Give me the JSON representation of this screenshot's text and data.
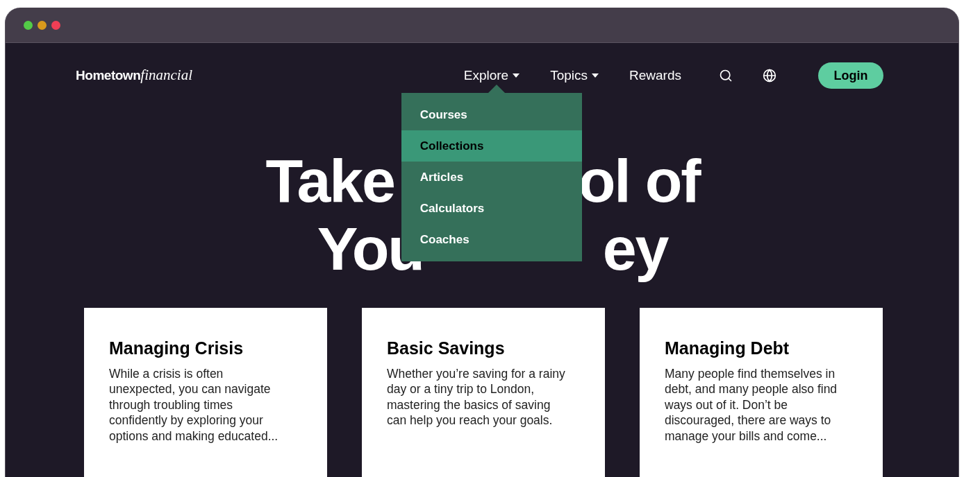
{
  "logo": {
    "bold": "Hometown",
    "italic": "financial"
  },
  "nav": [
    {
      "kind": "menu",
      "label": "Explore",
      "items": [
        {
          "label": "Courses",
          "selected": false
        },
        {
          "label": "Collections",
          "selected": true
        },
        {
          "label": "Articles",
          "selected": false
        },
        {
          "label": "Calculators",
          "selected": false
        },
        {
          "label": "Coaches",
          "selected": false
        }
      ]
    },
    {
      "kind": "menu",
      "label": "Topics"
    },
    {
      "kind": "link",
      "label": "Rewards"
    }
  ],
  "login": "Login",
  "headline": {
    "line_1": [
      "Take",
      "ol of"
    ],
    "line_2": [
      "You",
      "ey"
    ]
  },
  "cards": [
    {
      "title": "Managing Crisis",
      "text": "While a crisis is often unexpected, you can navigate through troubling times confidently by exploring your options and making educated..."
    },
    {
      "title": "Basic Savings",
      "text": "Whether you’re saving for a rainy day or a tiny trip to London, mastering the basics of saving can help you reach your goals."
    },
    {
      "title": "Managing Debt",
      "text": "Many people find themselves in debt, and many people also find ways out of it. Don’t be discouraged, there are ways to manage your bills and come..."
    }
  ]
}
